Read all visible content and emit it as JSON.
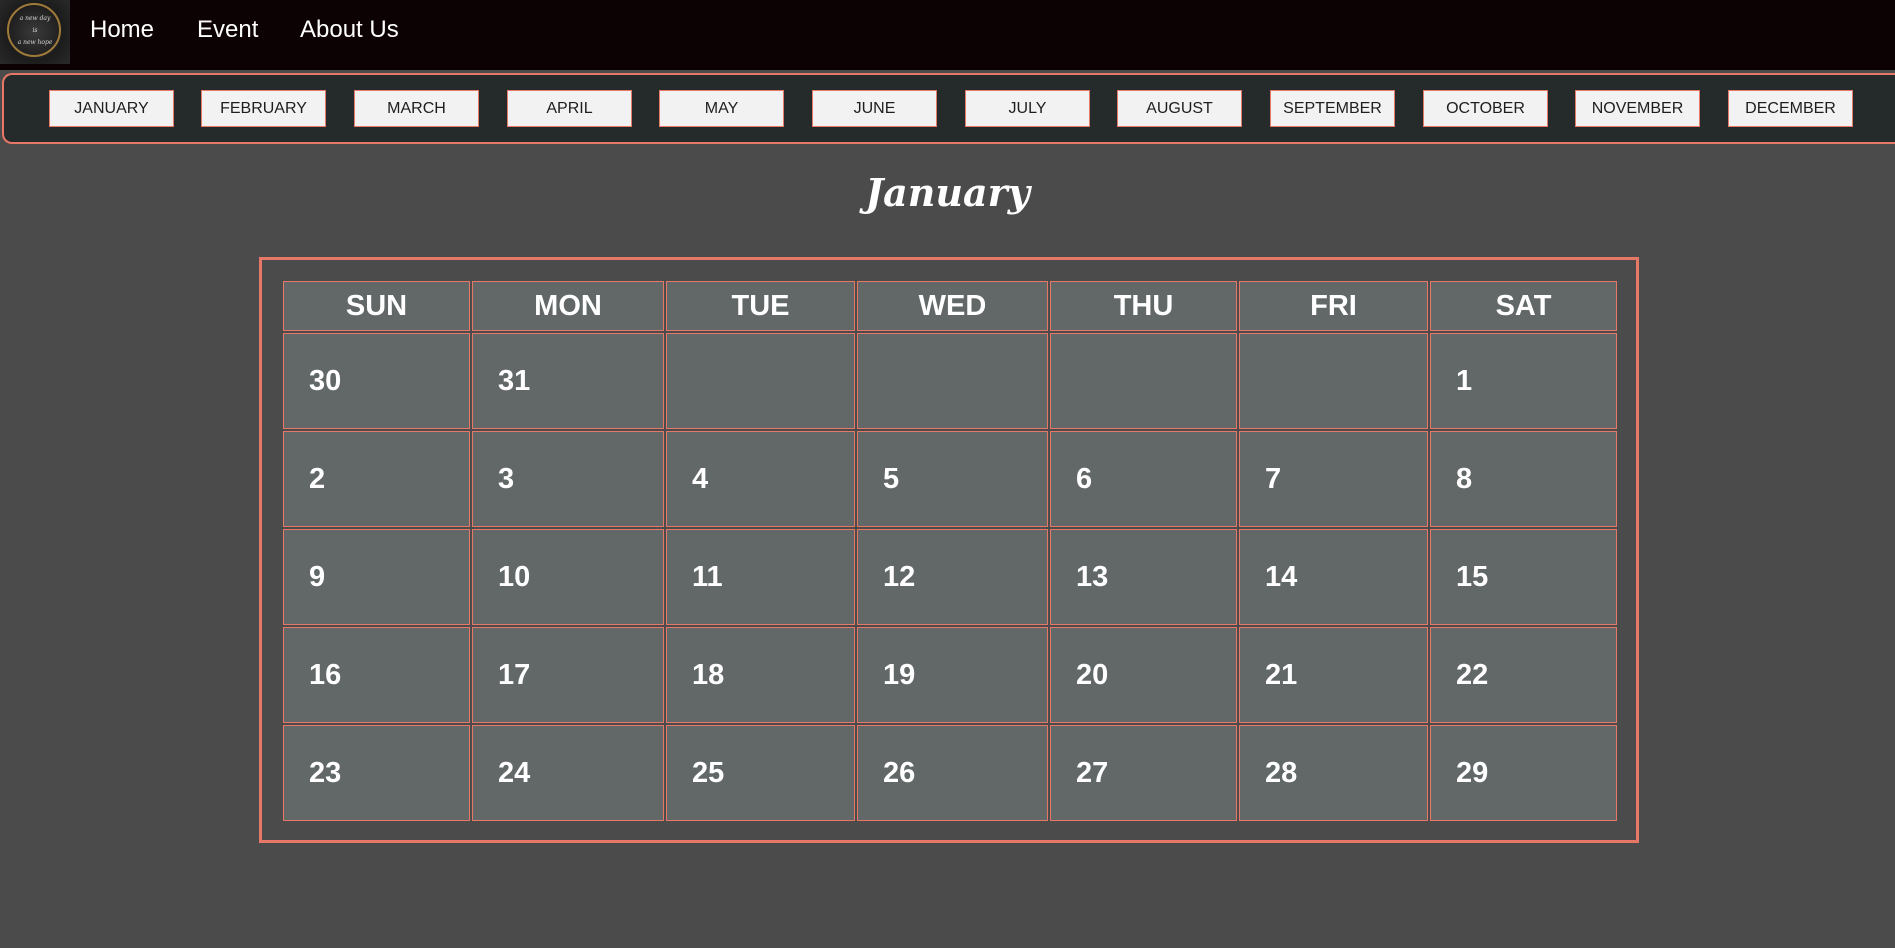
{
  "nav": {
    "logo_lines": [
      "a new day",
      "is",
      "a new hope"
    ],
    "links": [
      "Home",
      "Event",
      "About Us"
    ]
  },
  "months": [
    "JANUARY",
    "FEBRUARY",
    "MARCH",
    "APRIL",
    "MAY",
    "JUNE",
    "JULY",
    "AUGUST",
    "SEPTEMBER",
    "OCTOBER",
    "NOVEMBER",
    "DECEMBER"
  ],
  "calendar": {
    "title": "January",
    "weekdays": [
      "SUN",
      "MON",
      "TUE",
      "WED",
      "THU",
      "FRI",
      "SAT"
    ],
    "weeks": [
      [
        "30",
        "31",
        "",
        "",
        "",
        "",
        "1"
      ],
      [
        "2",
        "3",
        "4",
        "5",
        "6",
        "7",
        "8"
      ],
      [
        "9",
        "10",
        "11",
        "12",
        "13",
        "14",
        "15"
      ],
      [
        "16",
        "17",
        "18",
        "19",
        "20",
        "21",
        "22"
      ],
      [
        "23",
        "24",
        "25",
        "26",
        "27",
        "28",
        "29"
      ]
    ]
  },
  "colors": {
    "page_bg": "#4b4b4b",
    "topbar_bg": "#0d0203",
    "accent": "#e77766",
    "cell_bg": "#626868"
  }
}
